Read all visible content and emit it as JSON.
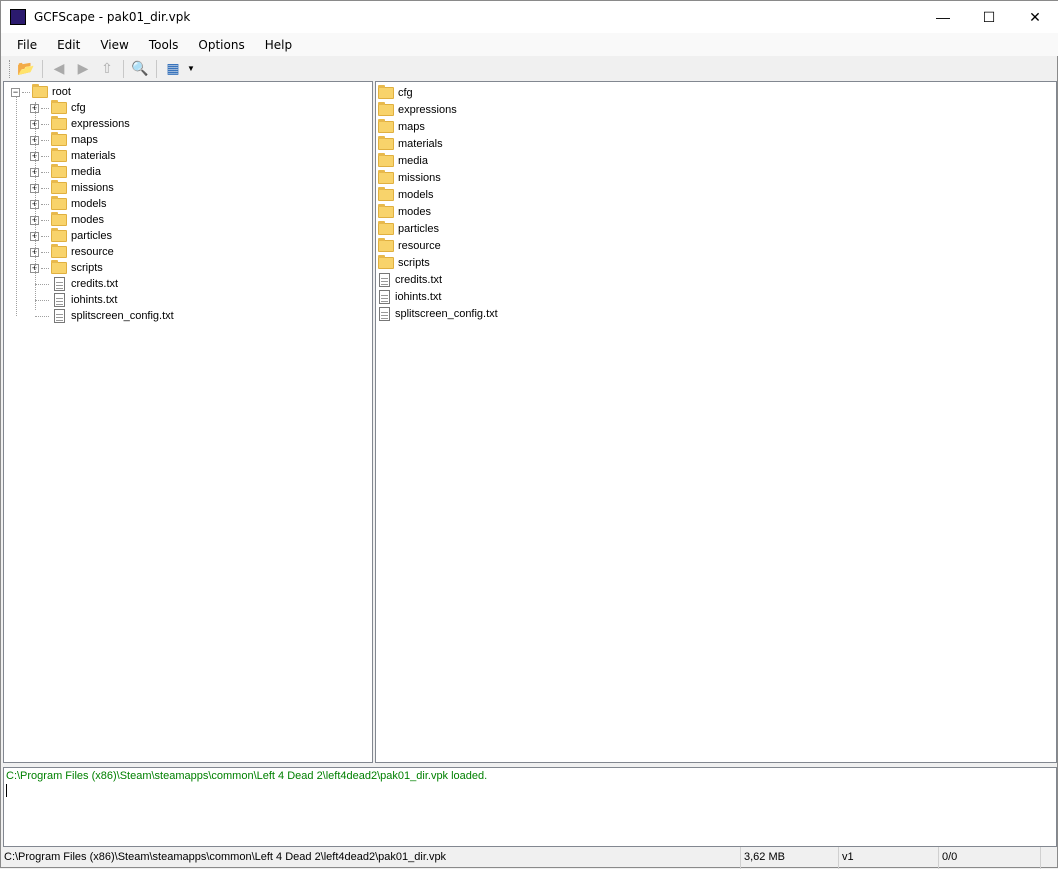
{
  "window": {
    "title": "GCFScape - pak01_dir.vpk"
  },
  "menu": [
    "File",
    "Edit",
    "View",
    "Tools",
    "Options",
    "Help"
  ],
  "toolbar": [
    "open-icon",
    "back-icon",
    "forward-icon",
    "up-icon",
    "find-icon",
    "view-mode-icon",
    "dropdown-icon"
  ],
  "tree": {
    "root": "root",
    "folders": [
      "cfg",
      "expressions",
      "maps",
      "materials",
      "media",
      "missions",
      "models",
      "modes",
      "particles",
      "resource",
      "scripts"
    ],
    "files": [
      "credits.txt",
      "iohints.txt",
      "splitscreen_config.txt"
    ]
  },
  "list": {
    "folders": [
      "cfg",
      "expressions",
      "maps",
      "materials",
      "media",
      "missions",
      "models",
      "modes",
      "particles",
      "resource",
      "scripts"
    ],
    "files": [
      "credits.txt",
      "iohints.txt",
      "splitscreen_config.txt"
    ]
  },
  "log": {
    "message": "C:\\Program Files (x86)\\Steam\\steamapps\\common\\Left 4 Dead 2\\left4dead2\\pak01_dir.vpk loaded.",
    "color": "#008000"
  },
  "status": {
    "path": "C:\\Program Files (x86)\\Steam\\steamapps\\common\\Left 4 Dead 2\\left4dead2\\pak01_dir.vpk",
    "size": "3,62 MB",
    "version": "v1",
    "count": "0/0"
  }
}
